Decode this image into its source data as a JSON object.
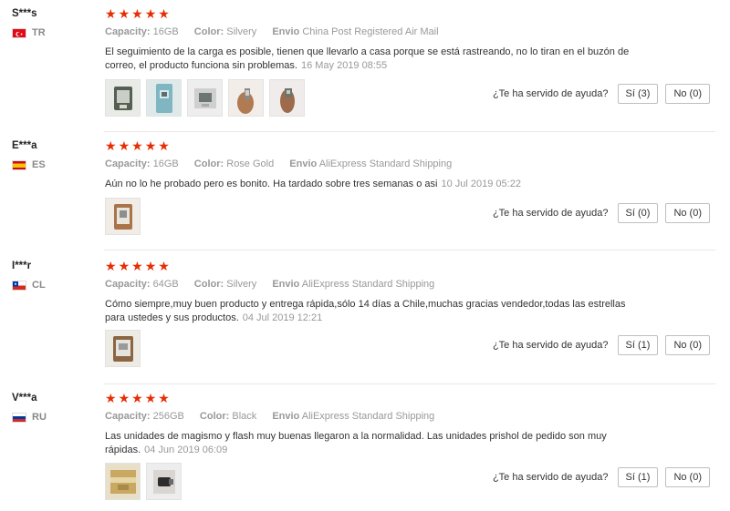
{
  "labels": {
    "capacity": "Capacity:",
    "color": "Color:",
    "shipping": "Envio",
    "helpful": "¿Te ha servido de ayuda?"
  },
  "reviews": [
    {
      "user": "S***s",
      "country": "TR",
      "flag_icon": "turkey-flag-icon",
      "rating": 5,
      "capacity": "16GB",
      "color": "Silvery",
      "shipping": "China Post Registered Air Mail",
      "text_line1": "El seguimiento de la carga es posible, tienen que llevarlo a casa porque se está rastreando, no lo tiran en el buzón de",
      "text_line2": "correo, el producto funciona sin problemas.",
      "date": "16 May 2019 08:55",
      "yes_label": "Sí (3)",
      "no_label": "No (0)",
      "photos": 5
    },
    {
      "user": "E***a",
      "country": "ES",
      "flag_icon": "spain-flag-icon",
      "rating": 5,
      "capacity": "16GB",
      "color": "Rose Gold",
      "shipping": "AliExpress Standard Shipping",
      "text_line1": "Aún no lo he probado pero es bonito. Ha tardado sobre tres semanas o asi",
      "text_line2": "",
      "date": "10 Jul 2019 05:22",
      "yes_label": "Sí (0)",
      "no_label": "No (0)",
      "photos": 1
    },
    {
      "user": "I***r",
      "country": "CL",
      "flag_icon": "chile-flag-icon",
      "rating": 5,
      "capacity": "64GB",
      "color": "Silvery",
      "shipping": "AliExpress Standard Shipping",
      "text_line1": "Cómo siempre,muy buen producto y entrega rápida,sólo 14 días a Chile,muchas gracias vendedor,todas las estrellas",
      "text_line2": "para ustedes y sus productos.",
      "date": "04 Jul 2019 12:21",
      "yes_label": "Sí (1)",
      "no_label": "No (0)",
      "photos": 1
    },
    {
      "user": "V***a",
      "country": "RU",
      "flag_icon": "russia-flag-icon",
      "rating": 5,
      "capacity": "256GB",
      "color": "Black",
      "shipping": "AliExpress Standard Shipping",
      "text_line1": "Las unidades de magismo y flash muy buenas llegaron a la normalidad. Las unidades prishol de pedido son muy",
      "text_line2": "rápidas.",
      "date": "04 Jun 2019 06:09",
      "yes_label": "Sí (1)",
      "no_label": "No (0)",
      "photos": 2
    }
  ],
  "colors": {
    "star": "#e62e04",
    "muted": "#999999",
    "text": "#333333"
  }
}
